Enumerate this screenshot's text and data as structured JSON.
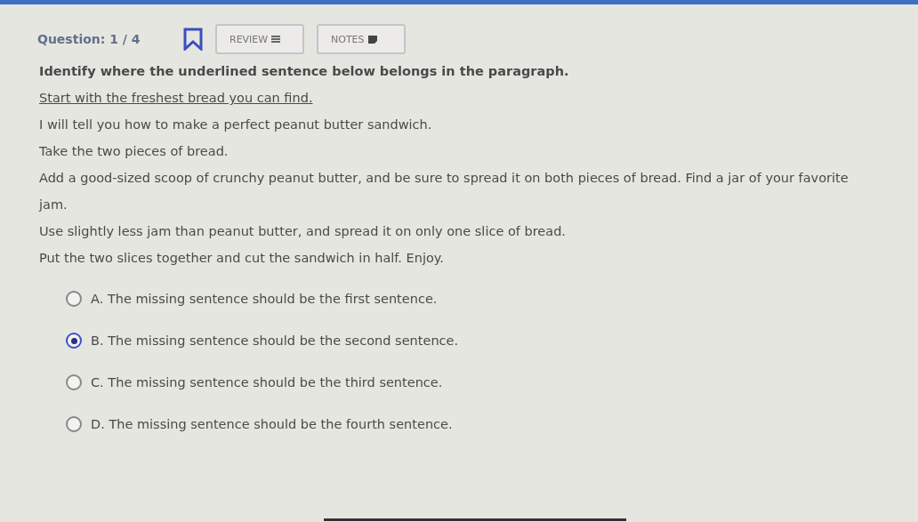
{
  "header": {
    "question_label": "Question: 1 / 4",
    "bookmarked": false,
    "buttons": [
      {
        "label": "REVIEW",
        "kind": "list"
      },
      {
        "label": "NOTES",
        "kind": "note"
      }
    ]
  },
  "prompt": "Identify where the underlined sentence below belongs in the paragraph.",
  "underlined_sentence": "Start with the freshest bread you can find.",
  "paragraph": [
    "I will tell you how to make a perfect peanut butter sandwich.",
    "Take the two pieces of bread.",
    "Add a good-sized scoop of crunchy peanut butter, and be sure to spread it on both pieces of bread. Find a jar of your favorite jam.",
    "Use slightly less jam than peanut butter, and spread it on only one slice of bread.",
    "Put the two slices together and cut the sandwich in half. Enjoy."
  ],
  "options": [
    {
      "label": "A. The missing sentence should be the first sentence.",
      "selected": false
    },
    {
      "label": "B. The missing sentence should be the second sentence.",
      "selected": true
    },
    {
      "label": "C. The missing sentence should be the third sentence.",
      "selected": false
    },
    {
      "label": "D. The missing sentence should be the fourth sentence.",
      "selected": false
    }
  ]
}
